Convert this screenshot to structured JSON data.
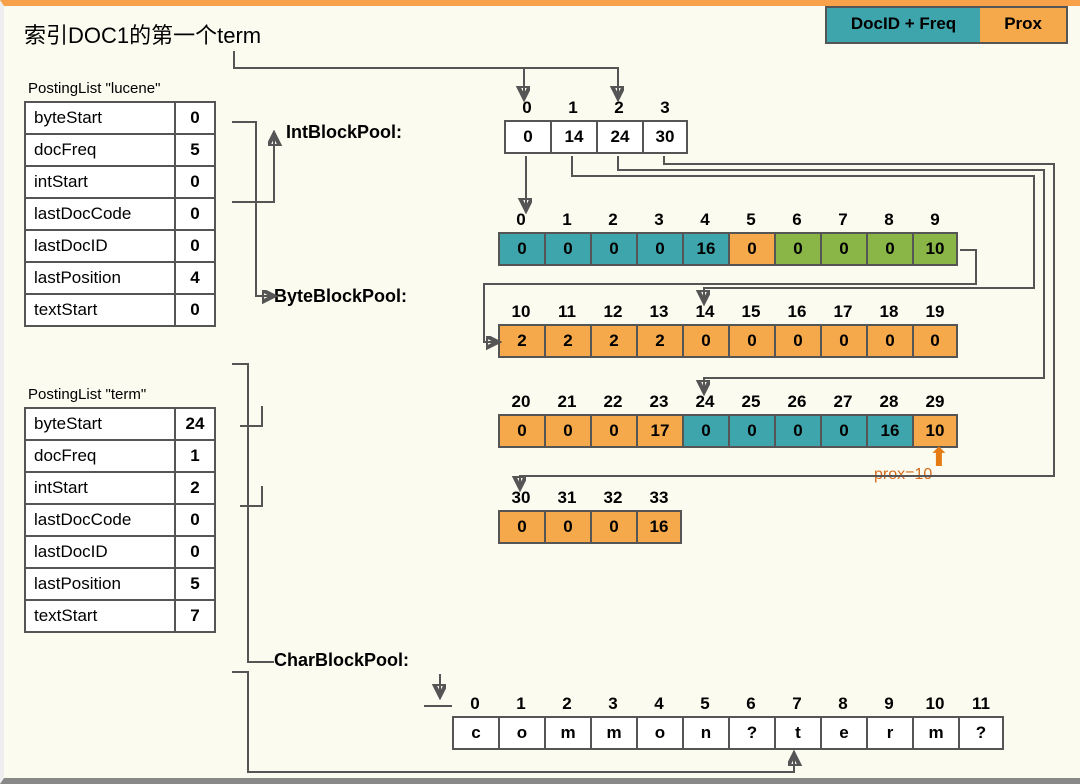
{
  "title": "索引DOC1的第一个term",
  "legend": {
    "docfreq": "DocID + Freq",
    "prox": "Prox"
  },
  "postingLists": [
    {
      "caption": "PostingList    \"lucene\"",
      "rows": [
        {
          "k": "byteStart",
          "v": "0"
        },
        {
          "k": "docFreq",
          "v": "5"
        },
        {
          "k": "intStart",
          "v": "0"
        },
        {
          "k": "lastDocCode",
          "v": "0"
        },
        {
          "k": "lastDocID",
          "v": "0"
        },
        {
          "k": "lastPosition",
          "v": "4"
        },
        {
          "k": "textStart",
          "v": "0"
        }
      ]
    },
    {
      "caption": "PostingList    \"term\"",
      "rows": [
        {
          "k": "byteStart",
          "v": "24"
        },
        {
          "k": "docFreq",
          "v": "1"
        },
        {
          "k": "intStart",
          "v": "2"
        },
        {
          "k": "lastDocCode",
          "v": "0"
        },
        {
          "k": "lastDocID",
          "v": "0"
        },
        {
          "k": "lastPosition",
          "v": "5"
        },
        {
          "k": "textStart",
          "v": "7"
        }
      ]
    }
  ],
  "poolLabels": {
    "int": "IntBlockPool:",
    "byte": "ByteBlockPool:",
    "char": "CharBlockPool:"
  },
  "intPool": {
    "idx": [
      "0",
      "1",
      "2",
      "3"
    ],
    "vals": [
      "0",
      "14",
      "24",
      "30"
    ],
    "cls": [
      "white",
      "white",
      "white",
      "white"
    ]
  },
  "byteRows": [
    {
      "idx": [
        "0",
        "1",
        "2",
        "3",
        "4",
        "5",
        "6",
        "7",
        "8",
        "9"
      ],
      "vals": [
        "0",
        "0",
        "0",
        "0",
        "16",
        "0",
        "0",
        "0",
        "0",
        "10"
      ],
      "cls": [
        "teal",
        "teal",
        "teal",
        "teal",
        "teal",
        "orange",
        "green",
        "green",
        "green",
        "green"
      ]
    },
    {
      "idx": [
        "10",
        "11",
        "12",
        "13",
        "14",
        "15",
        "16",
        "17",
        "18",
        "19"
      ],
      "vals": [
        "2",
        "2",
        "2",
        "2",
        "0",
        "0",
        "0",
        "0",
        "0",
        "0"
      ],
      "cls": [
        "orange",
        "orange",
        "orange",
        "orange",
        "orange",
        "orange",
        "orange",
        "orange",
        "orange",
        "orange"
      ]
    },
    {
      "idx": [
        "20",
        "21",
        "22",
        "23",
        "24",
        "25",
        "26",
        "27",
        "28",
        "29"
      ],
      "vals": [
        "0",
        "0",
        "0",
        "17",
        "0",
        "0",
        "0",
        "0",
        "16",
        "10"
      ],
      "cls": [
        "orange",
        "orange",
        "orange",
        "orange",
        "teal",
        "teal",
        "teal",
        "teal",
        "teal",
        "orange"
      ]
    },
    {
      "idx": [
        "30",
        "31",
        "32",
        "33"
      ],
      "vals": [
        "0",
        "0",
        "0",
        "16"
      ],
      "cls": [
        "orange",
        "orange",
        "orange",
        "orange"
      ]
    }
  ],
  "annotation": {
    "prox": "prox=10"
  },
  "charPool": {
    "idx": [
      "0",
      "1",
      "2",
      "3",
      "4",
      "5",
      "6",
      "7",
      "8",
      "9",
      "10",
      "11"
    ],
    "vals": [
      "c",
      "o",
      "m",
      "m",
      "o",
      "n",
      "?",
      "t",
      "e",
      "r",
      "m",
      "?"
    ]
  }
}
